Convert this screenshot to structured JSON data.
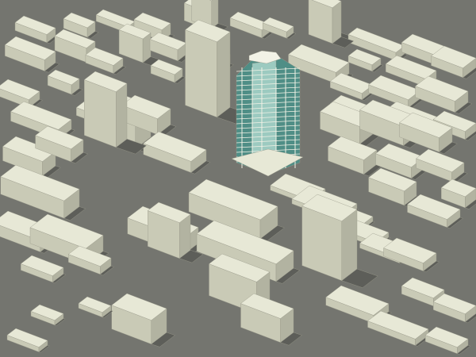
{
  "scene": {
    "description_label": "",
    "colors": {
      "ground": "#74756f",
      "building_top": "#e7e8d6",
      "building_left": "#c9cab6",
      "building_right": "#b2b3a1",
      "shadow": "#5d5e59",
      "tower_glass": "#4f8e86",
      "tower_glass_light": "#9ccac0",
      "tower_frame": "#f2f2e6"
    }
  }
}
